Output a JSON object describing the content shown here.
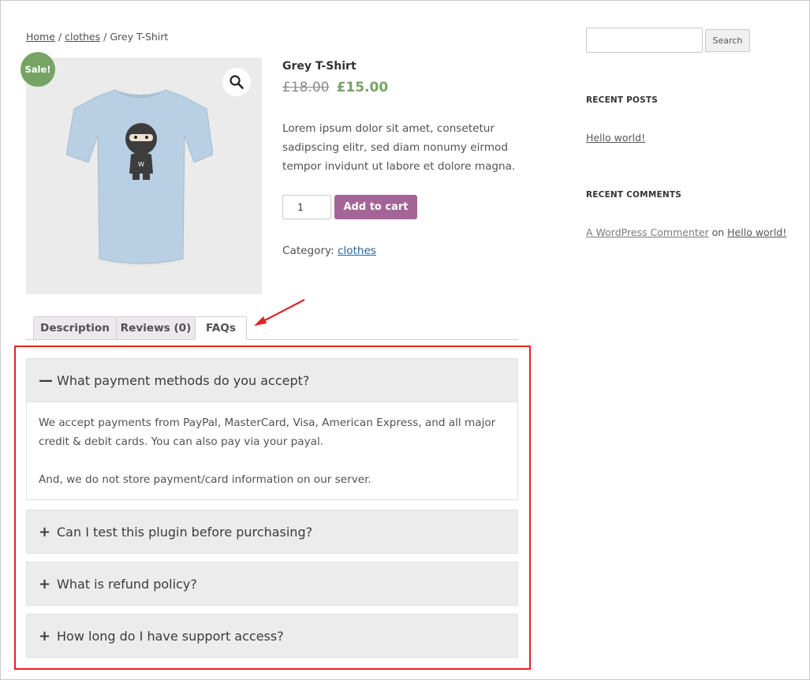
{
  "breadcrumb": {
    "home": "Home",
    "sep1": "/",
    "category": "clothes",
    "sep2": "/",
    "current": "Grey T-Shirt"
  },
  "product": {
    "sale_badge": "Sale!",
    "title": "Grey T-Shirt",
    "price_old": "£18.00",
    "price_new": "£15.00",
    "description": "Lorem ipsum dolor sit amet, consetetur sadipscing elitr, sed diam nonumy eirmod tempor invidunt ut labore et dolore magna.",
    "quantity": "1",
    "add_to_cart_label": "Add to cart",
    "category_label": "Category:",
    "category_value": "clothes",
    "image_bg": "#ebebeb",
    "shirt_color": "#b9cfe3"
  },
  "tabs": [
    {
      "label": "Description"
    },
    {
      "label": "Reviews (0)"
    },
    {
      "label": "FAQs"
    }
  ],
  "faqs": [
    {
      "icon": "minus-icon",
      "question": "What payment methods do you accept?",
      "answer_p1": "We accept payments from PayPal, MasterCard, Visa, American Express, and all major credit & debit cards. You can also pay via your payal.",
      "answer_p2": "And, we do not store payment/card information on our server."
    },
    {
      "icon": "plus-icon",
      "question": "Can I test this plugin before purchasing?"
    },
    {
      "icon": "plus-icon",
      "question": "What is refund policy?"
    },
    {
      "icon": "plus-icon",
      "question": "How long do I have support access?"
    }
  ],
  "sidebar": {
    "search_placeholder": "",
    "search_button": "Search",
    "recent_posts_title": "RECENT POSTS",
    "recent_post_1": "Hello world!",
    "recent_comments_title": "RECENT COMMENTS",
    "comment_author": "A WordPress Commenter",
    "comment_on": "on",
    "comment_post": "Hello world!"
  },
  "colors": {
    "sale_green": "#77a464",
    "button_purple": "#a46497",
    "annotation_red": "#e02424"
  }
}
